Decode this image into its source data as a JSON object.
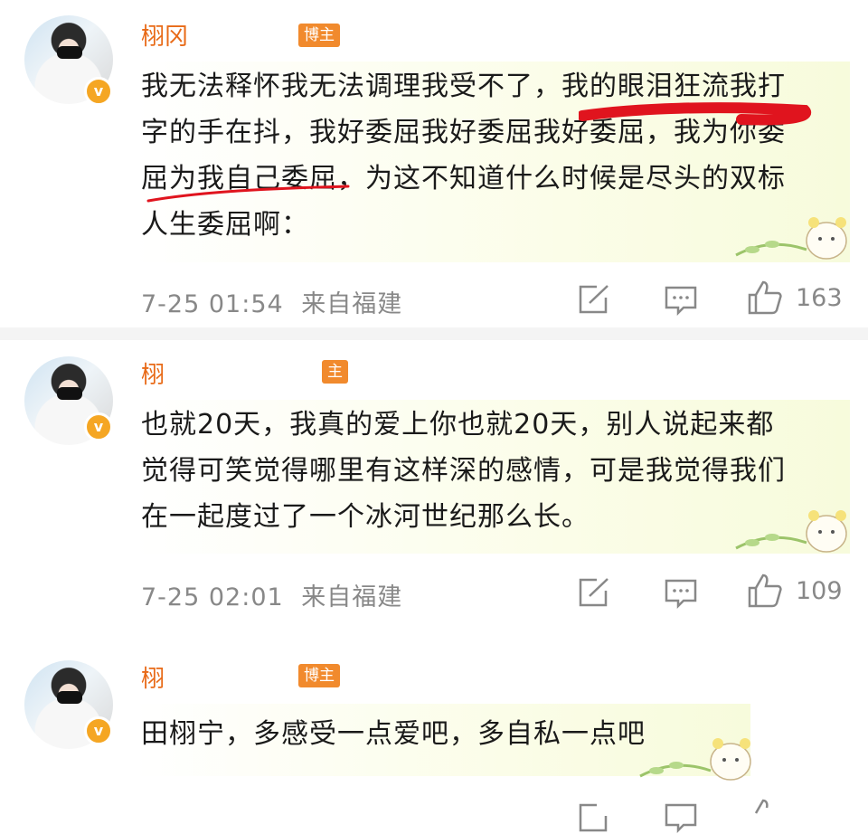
{
  "comments": [
    {
      "name": "栩",
      "name_tail": "冈",
      "tag": "博主",
      "lines": [
        "我无法释怀我无法调理我受不了，我的眼泪狂流我打",
        "字的手在抖，我好委屈我好委屈我好委屈，我为你委",
        "屈为我自己委屈，为这不知道什么时候是尽头的双标",
        "人生委屈啊："
      ],
      "time": "7-25 01:54",
      "source": "来自福建",
      "likes": "163"
    },
    {
      "name": "栩",
      "name_tail": "",
      "tag": "主",
      "lines": [
        "也就20天，我真的爱上你也就20天，别人说起来都",
        "觉得可笑觉得哪里有这样深的感情，可是我觉得我们",
        "在一起度过了一个冰河世纪那么长。"
      ],
      "time": "7-25 02:01",
      "source": "来自福建",
      "likes": "109"
    },
    {
      "name": "栩",
      "name_tail": "",
      "tag": "博主",
      "lines": [
        "田栩宁，多感受一点爱吧，多自私一点吧"
      ],
      "time": "",
      "source": "",
      "likes": ""
    }
  ],
  "icons": {
    "share": "share-icon",
    "comment": "comment-icon",
    "like": "thumbs-up-icon",
    "verified": "verified-badge-icon"
  },
  "colors": {
    "name": "#e86a17",
    "tag": "#f18a2d",
    "verified": "#f5a623",
    "underline": "#e0141e",
    "meta": "#888888"
  }
}
